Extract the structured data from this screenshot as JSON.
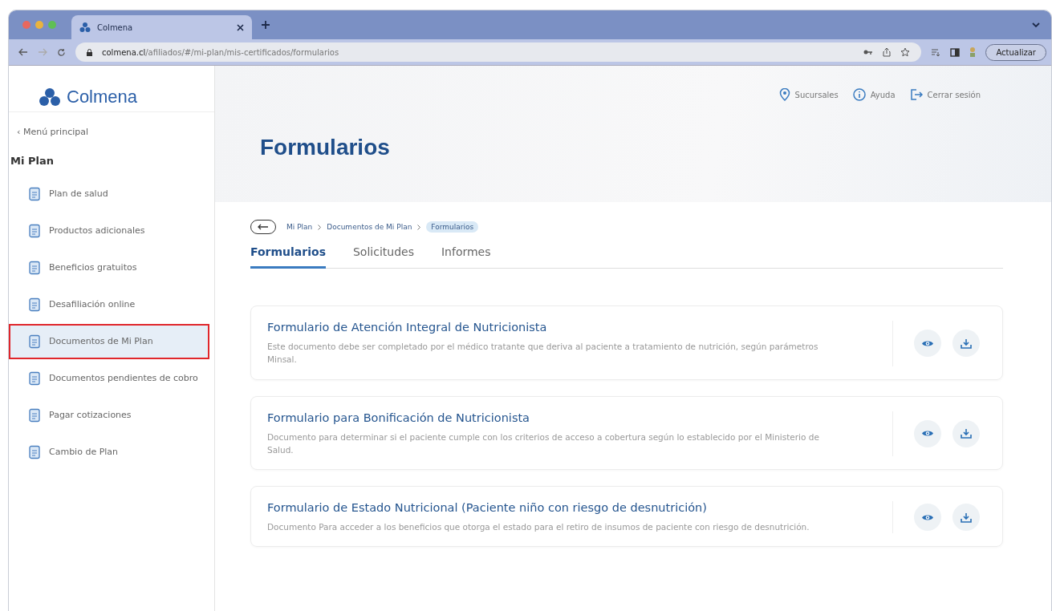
{
  "browser": {
    "tab_title": "Colmena",
    "url_host": "colmena.cl",
    "url_path": "/afiliados/#/mi-plan/mis-certificados/formularios",
    "update_button": "Actualizar"
  },
  "logo": "Colmena",
  "header_links": [
    {
      "kind": "pin",
      "label": "Sucursales"
    },
    {
      "kind": "info",
      "label": "Ayuda"
    },
    {
      "kind": "logout",
      "label": "Cerrar sesión"
    }
  ],
  "sidebar": {
    "back_link": "‹ Menú principal",
    "section": "Mi Plan",
    "items": [
      {
        "label": "Plan de salud",
        "selected": false
      },
      {
        "label": "Productos adicionales",
        "selected": false
      },
      {
        "label": "Beneficios gratuitos",
        "selected": false
      },
      {
        "label": "Desafiliación online",
        "selected": false
      },
      {
        "label": "Documentos de Mi Plan",
        "selected": true
      },
      {
        "label": "Documentos pendientes de cobro",
        "selected": false
      },
      {
        "label": "Pagar cotizaciones",
        "selected": false
      },
      {
        "label": "Cambio de Plan",
        "selected": false
      }
    ]
  },
  "page_title": "Formularios",
  "breadcrumb": [
    {
      "label": "Mi Plan",
      "selected": false
    },
    {
      "label": "Documentos de Mi Plan",
      "selected": false
    },
    {
      "label": "Formularios",
      "selected": true
    }
  ],
  "tabs": [
    {
      "label": "Formularios",
      "selected": true
    },
    {
      "label": "Solicitudes",
      "selected": false
    },
    {
      "label": "Informes",
      "selected": false
    }
  ],
  "documents": [
    {
      "title": "Formulario de Atención Integral de Nutricionista",
      "description": "Este documento debe ser completado por el médico tratante que deriva al paciente a tratamiento de nutrición, según parámetros Minsal."
    },
    {
      "title": "Formulario para Bonificación de Nutricionista",
      "description": "Documento para determinar si el paciente cumple con los criterios de acceso a cobertura según lo establecido por el Ministerio de Salud."
    },
    {
      "title": "Formulario de Estado Nutricional (Paciente niño con riesgo de desnutrición)",
      "description": "Documento Para acceder a los beneficios que otorga el estado para el retiro de insumos de paciente con riesgo de desnutrición."
    }
  ]
}
